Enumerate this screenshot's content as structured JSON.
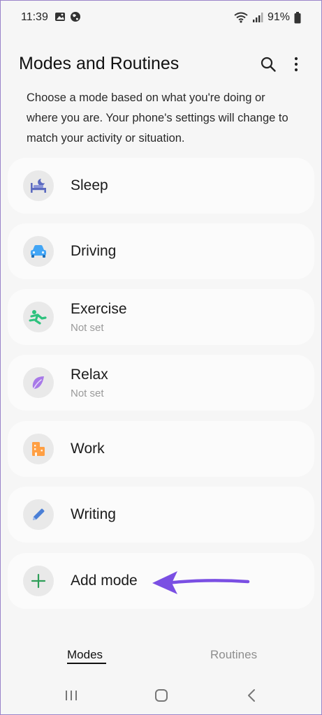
{
  "status_bar": {
    "time": "11:39",
    "battery": "91%",
    "icons_left": [
      "gallery-icon",
      "globe-icon"
    ],
    "icons_right": [
      "wifi-icon",
      "signal-icon",
      "battery-icon"
    ]
  },
  "header": {
    "title": "Modes and Routines",
    "actions": [
      "search-icon",
      "more-options-icon"
    ]
  },
  "description": "Choose a mode based on what you're doing or where you are. Your phone's settings will change to match your activity or situation.",
  "modes": [
    {
      "label": "Sleep",
      "subtitle": "",
      "icon": "bed-moon-icon",
      "color": "#5c6bc0"
    },
    {
      "label": "Driving",
      "subtitle": "",
      "icon": "car-icon",
      "color": "#42a5f5"
    },
    {
      "label": "Exercise",
      "subtitle": "Not set",
      "icon": "runner-icon",
      "color": "#2ec27e"
    },
    {
      "label": "Relax",
      "subtitle": "Not set",
      "icon": "leaf-icon",
      "color": "#a879e8"
    },
    {
      "label": "Work",
      "subtitle": "",
      "icon": "building-icon",
      "color": "#ff9f43"
    },
    {
      "label": "Writing",
      "subtitle": "",
      "icon": "pencil-icon",
      "color": "#4a7fd6"
    }
  ],
  "add_mode": {
    "label": "Add mode",
    "icon": "plus-icon",
    "color": "#2e9e58"
  },
  "annotation": {
    "icon": "arrow-left-icon",
    "color": "#7a4fe3"
  },
  "tabs": [
    {
      "label": "Modes",
      "active": true
    },
    {
      "label": "Routines",
      "active": false
    }
  ],
  "nav_bar": [
    "recent-apps-icon",
    "home-icon",
    "back-icon"
  ]
}
